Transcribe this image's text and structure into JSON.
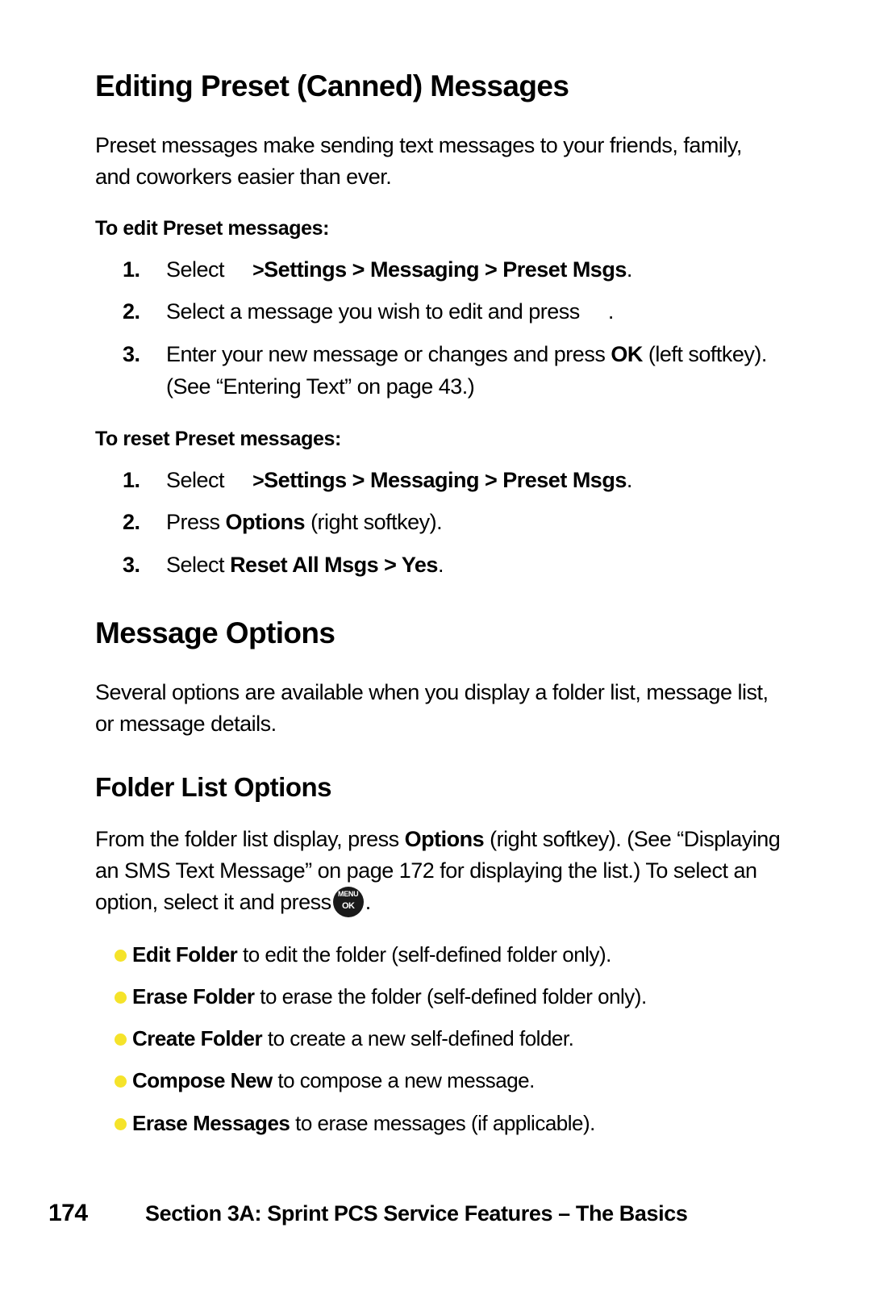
{
  "page": {
    "number": "174",
    "footer_text": "Section 3A: Sprint PCS Service Features – The Basics"
  },
  "sections": {
    "editing_preset": {
      "title": "Editing Preset (Canned) Messages",
      "intro": "Preset messages make sending text messages to your friends, family, and coworkers easier than ever.",
      "edit_lead_in": "To edit Preset messages:",
      "edit_steps": [
        {
          "num": "1.",
          "prefix": "Select",
          "arrow": ">",
          "path": "Settings > Messaging > Preset Msgs",
          "suffix": "."
        },
        {
          "num": "2.",
          "text": "Select a message you wish to edit and press",
          "suffix": "."
        },
        {
          "num": "3.",
          "pre": "Enter your new message or changes and press",
          "bold": "OK",
          "post": "(left softkey). (See “Entering Text” on page 43.)"
        }
      ],
      "reset_lead_in": "To reset Preset messages:",
      "reset_steps": [
        {
          "num": "1.",
          "prefix": "Select",
          "arrow": ">",
          "path": "Settings > Messaging > Preset Msgs",
          "suffix": "."
        },
        {
          "num": "2.",
          "pre": "Press",
          "bold": "Options",
          "post": "(right softkey)."
        },
        {
          "num": "3.",
          "pre": "Select",
          "bold": "Reset All Msgs > Yes",
          "post": "."
        }
      ]
    },
    "message_options": {
      "title": "Message Options",
      "intro": "Several options are available when you display a folder list, message list, or message details."
    },
    "folder_list_options": {
      "title": "Folder List Options",
      "para_part1": "From the folder list display, press",
      "para_bold": "Options",
      "para_part2": "(right softkey). (See “Displaying an SMS Text Message” on page 172 for displaying the list.) To select an option, select it and press",
      "para_part3": ".",
      "menu_icon": {
        "name": "menu-ok-icon",
        "top_label": "MENU",
        "bottom_label": "OK"
      },
      "bullets": [
        {
          "bold": "Edit Folder",
          "rest": "to edit the folder (self-defined folder only)."
        },
        {
          "bold": "Erase Folder",
          "rest": "to erase the folder (self-defined folder only)."
        },
        {
          "bold": "Create Folder",
          "rest": "to create a new self-defined folder."
        },
        {
          "bold": "Compose New",
          "rest": "to compose a new message."
        },
        {
          "bold": "Erase Messages",
          "rest": "to erase messages (if applicable)."
        }
      ],
      "bullet_color": "#f5e32a"
    }
  }
}
